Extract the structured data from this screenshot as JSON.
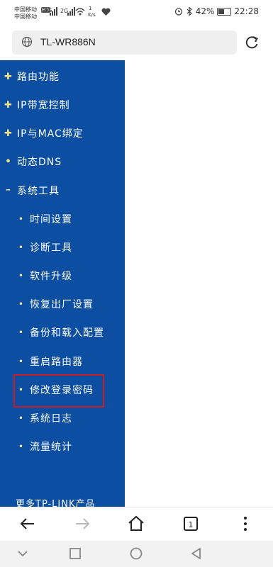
{
  "status_bar": {
    "carrier_1": "中国移动",
    "carrier_2": "中国移动",
    "hd_badge": "HD",
    "network_1": "4G",
    "network_2": "2G",
    "speed_value": "1",
    "speed_unit": "K/s",
    "battery": "42%",
    "time": "22:28"
  },
  "url_bar": {
    "url": "TL-WR886N"
  },
  "menu": {
    "items": [
      {
        "label": "路由功能",
        "marker": "✚"
      },
      {
        "label": "IP带宽控制",
        "marker": "✚"
      },
      {
        "label": "IP与MAC绑定",
        "marker": "✚"
      },
      {
        "label": "动态DNS",
        "marker": "•"
      },
      {
        "label": "系统工具",
        "marker": "━"
      }
    ],
    "sub_items": [
      {
        "label": "时间设置"
      },
      {
        "label": "诊断工具"
      },
      {
        "label": "软件升级"
      },
      {
        "label": "恢复出厂设置"
      },
      {
        "label": "备份和载入配置"
      },
      {
        "label": "重启路由器"
      },
      {
        "label": "修改登录密码"
      },
      {
        "label": "系统日志"
      },
      {
        "label": "流量统计"
      }
    ],
    "more_link": "更多TP-LINK产品"
  },
  "colors": {
    "sidebar": "#0b4ea2",
    "highlight": "#d01a22",
    "marker": "#f5e28a"
  },
  "icons": {
    "browser_bar": [
      "back-arrow-icon",
      "forward-arrow-icon",
      "home-icon",
      "tabs-icon",
      "more-vert-icon"
    ],
    "nav_bar": [
      "nav-collapse-icon",
      "nav-recents-icon",
      "nav-home-icon",
      "nav-back-icon"
    ]
  }
}
